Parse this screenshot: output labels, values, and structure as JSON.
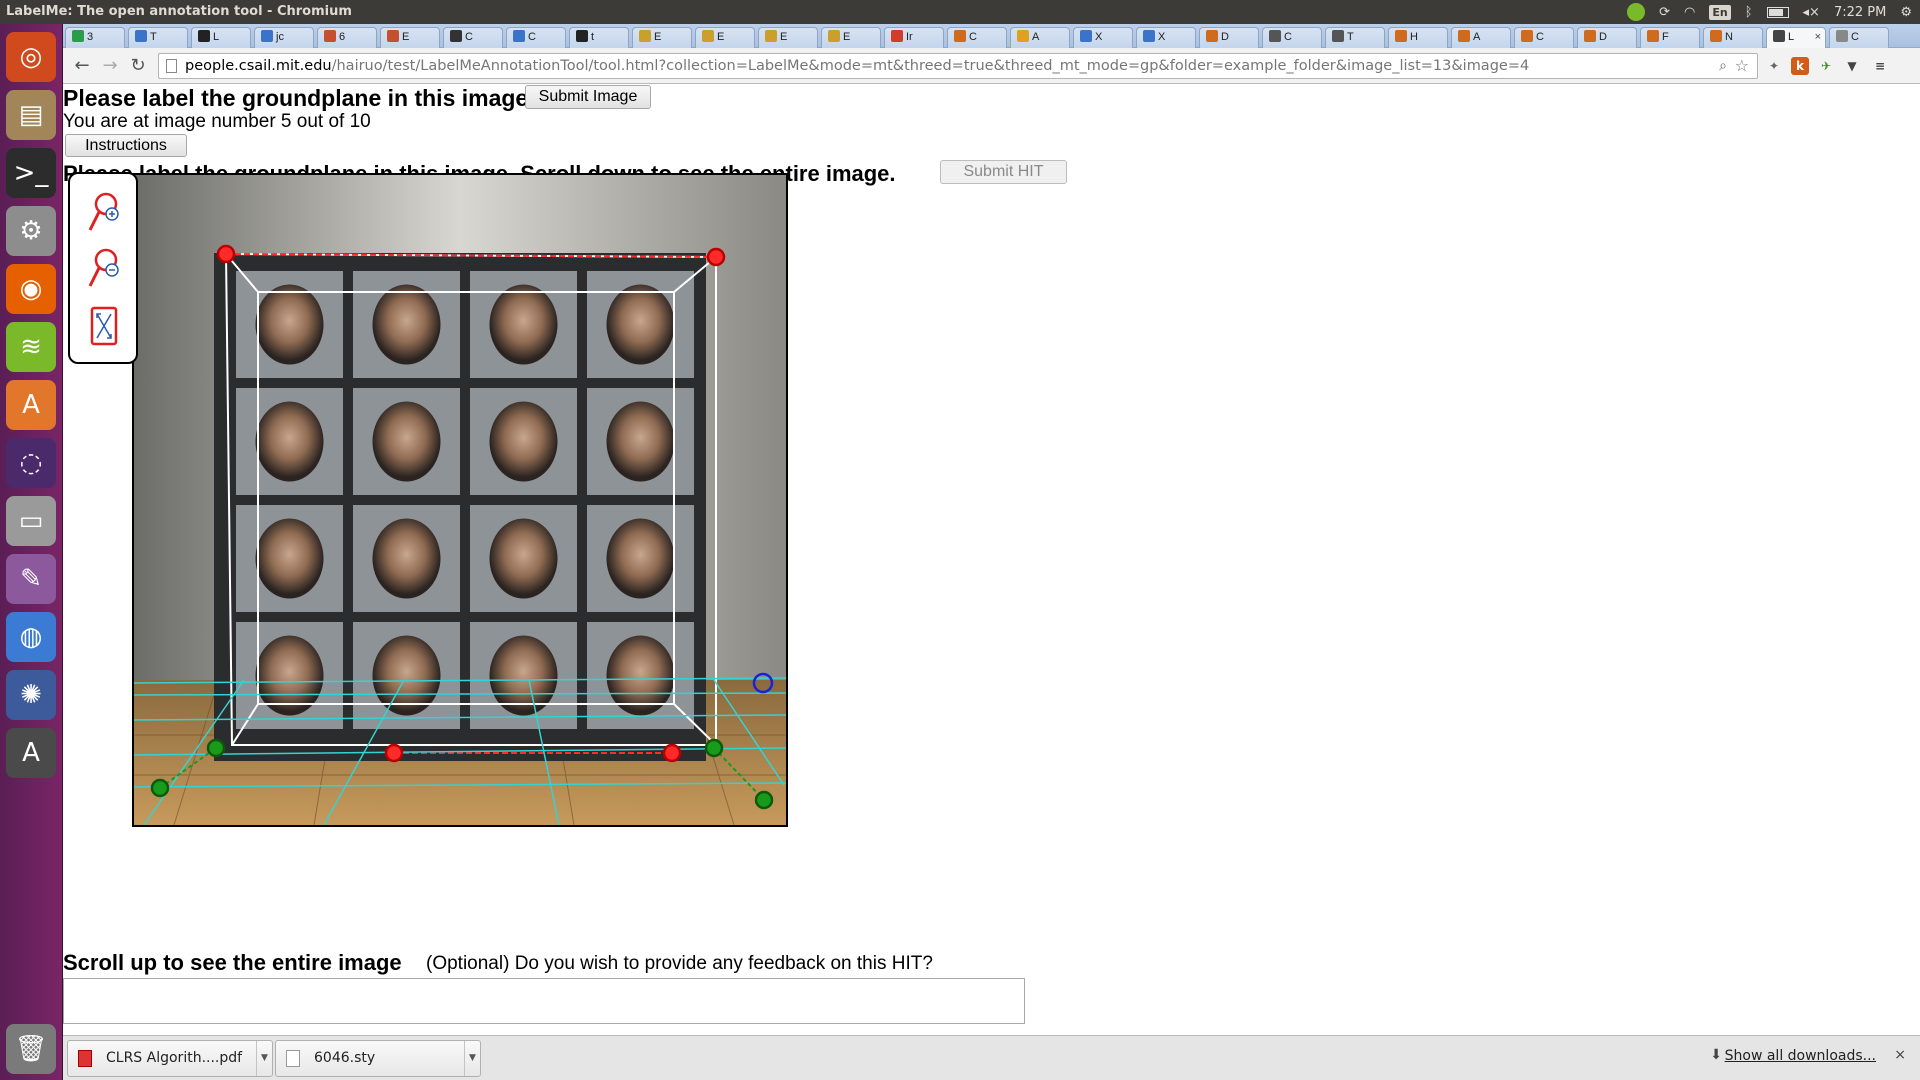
{
  "window": {
    "title": "LabelMe: The open annotation tool - Chromium"
  },
  "panel": {
    "lang": "En",
    "time": "7:22 PM"
  },
  "launcher": {
    "items": [
      {
        "name": "ubuntu-dash-icon",
        "glyph": "◎",
        "bg": "#d14a1e"
      },
      {
        "name": "files-icon",
        "glyph": "▤",
        "bg": "#a28659"
      },
      {
        "name": "terminal-icon",
        "glyph": ">_",
        "bg": "#2c2c2c"
      },
      {
        "name": "system-settings-icon",
        "glyph": "⚙",
        "bg": "#8d8d8d"
      },
      {
        "name": "firefox-icon",
        "glyph": "◉",
        "bg": "#e66000"
      },
      {
        "name": "spotify-icon",
        "glyph": "≋",
        "bg": "#7ab929"
      },
      {
        "name": "software-center-icon",
        "glyph": "A",
        "bg": "#e2762a"
      },
      {
        "name": "unity-control-icon",
        "glyph": "◌",
        "bg": "#4a2a6b"
      },
      {
        "name": "disk-icon",
        "glyph": "▭",
        "bg": "#9a9a9a"
      },
      {
        "name": "text-editor-icon",
        "glyph": "✎",
        "bg": "#8c5a9c"
      },
      {
        "name": "chromium-icon",
        "glyph": "◍",
        "bg": "#3b7bd3"
      },
      {
        "name": "shotwell-icon",
        "glyph": "✺",
        "bg": "#3d5a9a"
      },
      {
        "name": "software-updater-icon",
        "glyph": "A",
        "bg": "#4a4a4a"
      },
      {
        "name": "trash-icon",
        "glyph": "🗑",
        "bg": "#7a7a7a"
      }
    ]
  },
  "tabs": [
    {
      "label": "3",
      "color": "#2a9d4a"
    },
    {
      "label": "T",
      "color": "#3b73c8"
    },
    {
      "label": "L",
      "color": "#222222"
    },
    {
      "label": "jc",
      "color": "#3b73c8"
    },
    {
      "label": "6",
      "color": "#c4502f"
    },
    {
      "label": "E",
      "color": "#c4502f"
    },
    {
      "label": "C",
      "color": "#333333"
    },
    {
      "label": "C",
      "color": "#3b73c8"
    },
    {
      "label": "t",
      "color": "#222222"
    },
    {
      "label": "E",
      "color": "#caa02a"
    },
    {
      "label": "E",
      "color": "#caa02a"
    },
    {
      "label": "E",
      "color": "#caa02a"
    },
    {
      "label": "E",
      "color": "#caa02a"
    },
    {
      "label": "Ir",
      "color": "#d33b2a"
    },
    {
      "label": "C",
      "color": "#d06b1e"
    },
    {
      "label": "A",
      "color": "#e0a020"
    },
    {
      "label": "X",
      "color": "#3b73c8"
    },
    {
      "label": "X",
      "color": "#3b73c8"
    },
    {
      "label": "D",
      "color": "#d06b1e"
    },
    {
      "label": "C",
      "color": "#555555"
    },
    {
      "label": "T",
      "color": "#555555"
    },
    {
      "label": "H",
      "color": "#d06b1e"
    },
    {
      "label": "A",
      "color": "#d06b1e"
    },
    {
      "label": "C",
      "color": "#d06b1e"
    },
    {
      "label": "D",
      "color": "#d06b1e"
    },
    {
      "label": "F",
      "color": "#d06b1e"
    },
    {
      "label": "N",
      "color": "#d06b1e"
    },
    {
      "label": "L",
      "color": "#444444",
      "active": true
    },
    {
      "label": "C",
      "color": "#888888"
    }
  ],
  "toolbar": {
    "url_host": "people.csail.mit.edu",
    "url_rest": "/hairuo/test/LabelMeAnnotationTool/tool.html?collection=LabelMe&mode=mt&threed=true&threed_mt_mode=gp&folder=example_folder&image_list=13&image=4"
  },
  "page": {
    "title": "Please label the groundplane in this image.",
    "submit_image": "Submit Image",
    "progress_text": "You are at image number 5 out of 10",
    "instructions": "Instructions",
    "heading2": "Please label the groundplane in this image. Scroll down to see the entire image.",
    "submit_hit": "Submit HIT",
    "scroll_up": "Scroll up to see the entire image",
    "feedback_question": "(Optional) Do you wish to provide any feedback on this HIT?"
  },
  "downloads": {
    "items": [
      {
        "name": "CLRS Algorith....pdf",
        "type": "pdf"
      },
      {
        "name": "6046.sty",
        "type": "file"
      }
    ],
    "show_all": "Show all downloads..."
  }
}
